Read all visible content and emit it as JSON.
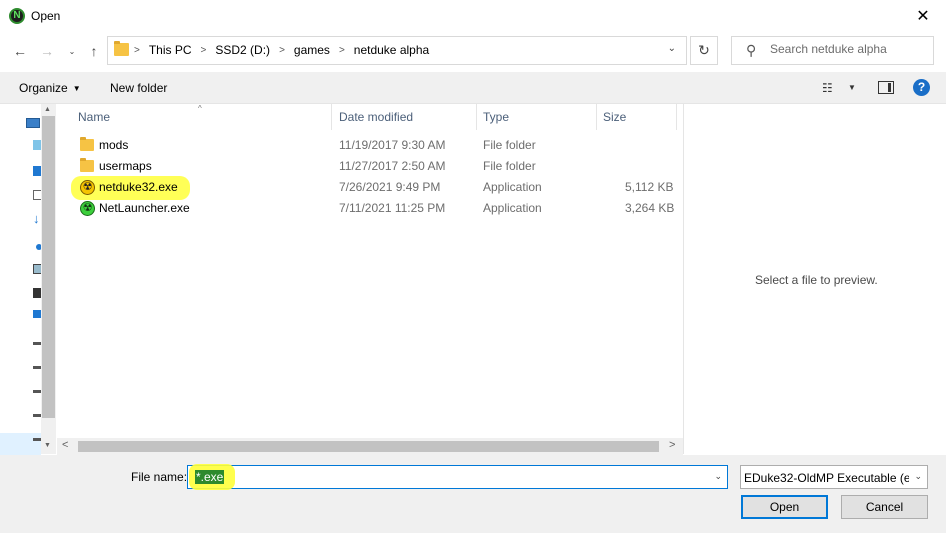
{
  "window": {
    "title": "Open",
    "app_icon_letter": "N"
  },
  "address": {
    "crumbs": [
      "This PC",
      "SSD2 (D:)",
      "games",
      "netduke alpha"
    ]
  },
  "search": {
    "placeholder": "Search netduke alpha"
  },
  "command_bar": {
    "organize": "Organize",
    "new_folder": "New folder"
  },
  "columns": {
    "name": "Name",
    "date": "Date modified",
    "type": "Type",
    "size": "Size"
  },
  "files": [
    {
      "name": "mods",
      "date": "11/19/2017 9:30 AM",
      "type": "File folder",
      "size": "",
      "icon": "folder-icon"
    },
    {
      "name": "usermaps",
      "date": "11/27/2017 2:50 AM",
      "type": "File folder",
      "size": "",
      "icon": "folder-icon"
    },
    {
      "name": "netduke32.exe",
      "date": "7/26/2021 9:49 PM",
      "type": "Application",
      "size": "5,112 KB",
      "icon": "radiation-yellow-icon"
    },
    {
      "name": "NetLauncher.exe",
      "date": "7/11/2021 11:25 PM",
      "type": "Application",
      "size": "3,264 KB",
      "icon": "radiation-green-icon"
    }
  ],
  "preview": {
    "empty_text": "Select a file to preview."
  },
  "bottom": {
    "file_name_label": "File name:",
    "file_name_value": "*.exe",
    "filter_value": "EDuke32-OldMP Executable  (e",
    "open_label": "Open",
    "cancel_label": "Cancel"
  },
  "colors": {
    "accent": "#0078d7",
    "highlight": "#ffff3a",
    "help": "#1a6ec7"
  }
}
